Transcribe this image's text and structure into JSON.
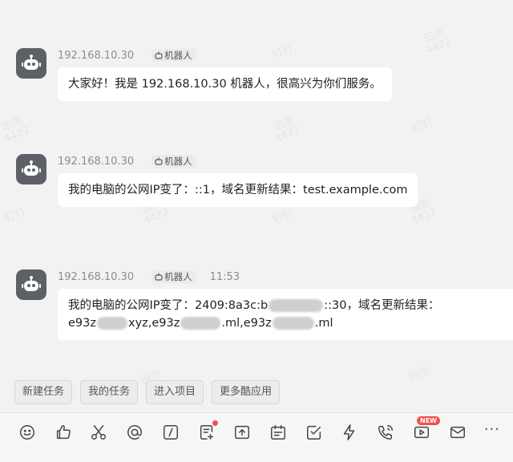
{
  "messages": [
    {
      "sender": "192.168.10.30",
      "tag": "机器人",
      "time": "",
      "text": "大家好！我是 192.168.10.30 机器人，很高兴为你们服务。"
    },
    {
      "sender": "192.168.10.30",
      "tag": "机器人",
      "time": "",
      "text": "我的电脑的公网IP变了：::1，域名更新结果：test.example.com"
    },
    {
      "sender": "192.168.10.30",
      "tag": "机器人",
      "time": "11:53",
      "line1_a": "我的电脑的公网IP变了：2409:8a3c:b",
      "line1_b": "::30，域名更新结果：",
      "line2_a": "e93z",
      "line2_b": "xyz,e93z",
      "line2_c": ".ml,e93z",
      "line2_d": ".ml"
    }
  ],
  "quick_actions": [
    "新建任务",
    "我的任务",
    "进入项目",
    "更多酷应用"
  ],
  "toolbar": {
    "icons": [
      "emoji-icon",
      "thumbs-up-icon",
      "scissors-icon",
      "at-icon",
      "slash-command-icon",
      "note-add-icon",
      "upload-icon",
      "calendar-icon",
      "checkbox-icon",
      "lightning-icon",
      "phone-icon",
      "video-icon",
      "mail-icon",
      "more-icon"
    ],
    "new_badge": "NEW",
    "more": "···"
  },
  "watermark": {
    "name": "田雨",
    "id": "4422",
    "app": "钉钉"
  },
  "colors": {
    "avatar": "#5d6167",
    "badge_red": "#f2514b",
    "bubble": "#ffffff",
    "background": "#f2f2f3"
  }
}
